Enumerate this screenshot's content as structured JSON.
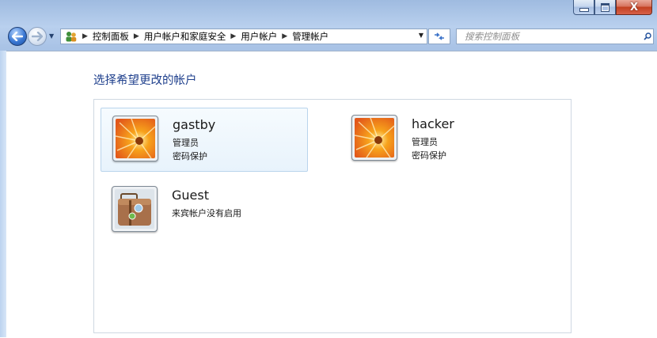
{
  "window": {
    "minimize_label": "–",
    "maximize_label": "□",
    "close_label": "X"
  },
  "address": {
    "crumbs": [
      "控制面板",
      "用户帐户和家庭安全",
      "用户帐户",
      "管理帐户"
    ]
  },
  "search": {
    "placeholder": "搜索控制面板"
  },
  "page": {
    "title": "选择希望更改的帐户"
  },
  "accounts": [
    {
      "name": "gastby",
      "type": "管理员",
      "status": "密码保护"
    },
    {
      "name": "hacker",
      "type": "管理员",
      "status": "密码保护"
    },
    {
      "name": "Guest",
      "type": "来宾帐户没有启用"
    }
  ],
  "colors": {
    "title_blue": "#1e3f8c",
    "selection_bg": "#e8f3fc",
    "close_red": "#c2401f"
  }
}
